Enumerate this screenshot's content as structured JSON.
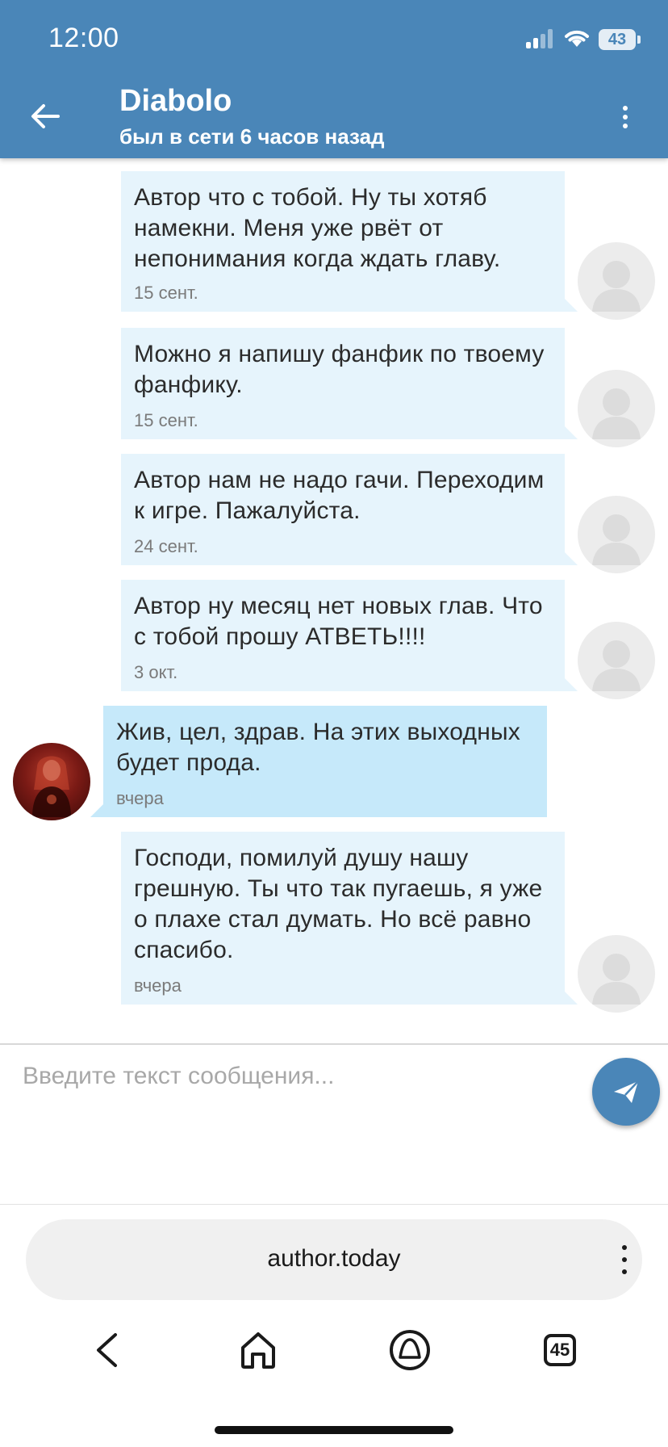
{
  "status_bar": {
    "time": "12:00",
    "battery": "43"
  },
  "header": {
    "title": "Diabolo",
    "subtitle": "был в сети 6 часов назад"
  },
  "messages": [
    {
      "author": "other",
      "text": "Автор что с тобой. Ну ты хотяб намекни. Меня уже рвёт от непонимания когда ждать главу.",
      "date": "15 сент."
    },
    {
      "author": "other",
      "text": "Можно я напишу фанфик по твоему фанфику.",
      "date": "15 сент."
    },
    {
      "author": "other",
      "text": "Автор нам не надо гачи. Переходим к игре. Пажалуйста.",
      "date": "24 сент."
    },
    {
      "author": "other",
      "text": "Автор ну месяц нет новых глав. Что с тобой прошу АТВЕТЬ!!!!",
      "date": "3 окт."
    },
    {
      "author": "me",
      "text": "Жив, цел, здрав. На этих выходных будет прода.",
      "date": "вчера"
    },
    {
      "author": "other",
      "text": "Господи, помилуй душу нашу грешную. Ты что так пугаешь, я уже о плахе стал думать. Но всё равно спасибо.",
      "date": "вчера"
    }
  ],
  "compose": {
    "placeholder": "Введите текст сообщения..."
  },
  "browser": {
    "url": "author.today",
    "tabs_count": "45"
  },
  "colors": {
    "header": "#4a86b8",
    "bubble_other": "#e6f4fc",
    "bubble_mine": "#c6e9fa",
    "send_button": "#4a86b8"
  },
  "icons": {
    "back": "arrow-left-icon",
    "more": "more-vertical-icon",
    "send": "send-icon",
    "nav_back": "chevron-left-icon",
    "home": "home-icon",
    "assistant": "assistant-icon"
  }
}
